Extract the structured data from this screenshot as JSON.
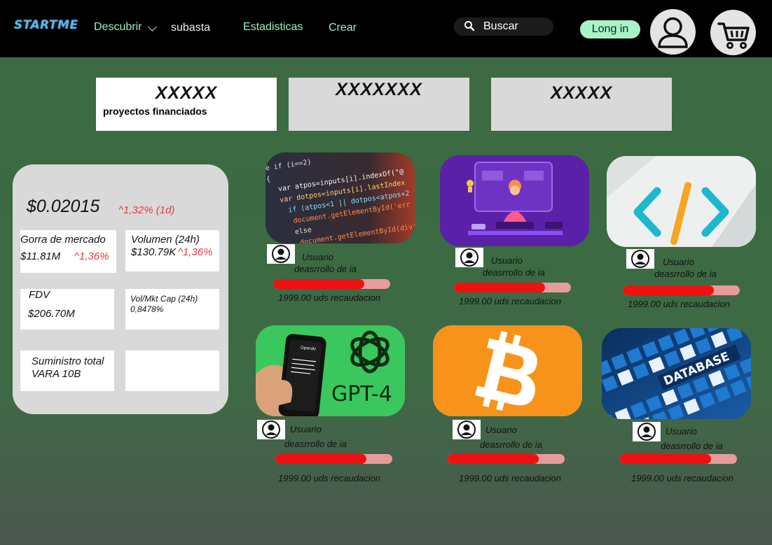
{
  "nav": {
    "logo": "STARTME",
    "discover": "Descubrir",
    "auction": "subasta",
    "stats": "Estadisticas",
    "create": "Crear",
    "search_placeholder": "Buscar",
    "login": "Long in",
    "avatar_icon": "user-icon",
    "cart_icon": "cart-icon"
  },
  "stats": [
    {
      "title": "XXXXX",
      "subtitle": "proyectos financiados"
    },
    {
      "title": "XXXXXXX"
    },
    {
      "title": "XXXXX"
    }
  ],
  "market": {
    "price": "$0.02015",
    "price_change": "^1,32% (1d)",
    "market_cap_label": "Gorra de mercado",
    "market_cap_value": "$11.81M",
    "market_cap_change": "^1,36%",
    "volume_label": "Volumen (24h)",
    "volume_value": "$130.79K",
    "volume_change": "^1,36%",
    "fdv_label": "FDV",
    "fdv_value": "$206.70M",
    "volmkt_label": "Vol/Mkt Cap (24h)",
    "volmkt_value": "0,8478%",
    "supply_label": "Suministro total",
    "supply_value": "VARA 10B"
  },
  "projects": [
    {
      "image": "code-screen",
      "user": "Usuario",
      "desc": "deasrrollo de ia",
      "progress": 0.78,
      "raised": "1999.00 uds recaudacion"
    },
    {
      "image": "developer-illustration",
      "user": "Usuario",
      "desc": "deasrrollo de ia",
      "progress": 0.78,
      "raised": "1999.00 uds recaudacion"
    },
    {
      "image": "code-tag-icon",
      "user": "Usuario",
      "desc": "deasrrollo de ia",
      "progress": 0.78,
      "raised": "1999.00 uds recaudacion"
    },
    {
      "image": "gpt4-phone",
      "user": "Usuario",
      "desc": "deasrrollo de ia",
      "progress": 0.78,
      "raised": "1999.00 uds recaudacion"
    },
    {
      "image": "bitcoin-logo",
      "user": "Usuario",
      "desc": "deasrrollo de ia",
      "progress": 0.78,
      "raised": "1999.00 uds recaudacion"
    },
    {
      "image": "database-tiles",
      "user": "Usuario",
      "desc": "deasrrollo de ia",
      "progress": 0.78,
      "raised": "1999.00 uds recaudacion"
    }
  ],
  "images_text": {
    "gpt_label": "GPT-4",
    "gpt_brand": "OpenAI",
    "db_label": "DATABASE"
  }
}
